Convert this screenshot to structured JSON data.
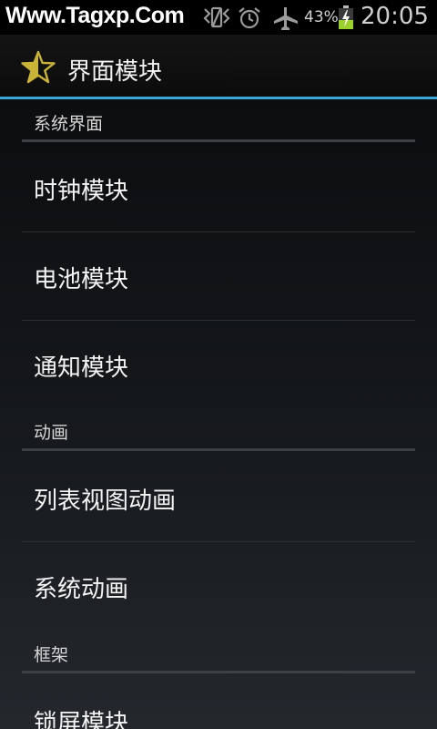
{
  "status_bar": {
    "watermark": "Www.Tagxp.Com",
    "battery_percent": "43%",
    "time": "20:05",
    "icons": [
      "vibrate-icon",
      "alarm-clock-icon",
      "airplane-mode-icon",
      "battery-charging-icon"
    ],
    "battery_level": 0.43
  },
  "action_bar": {
    "title": "界面模块",
    "icon": "star-icon",
    "accent_color": "#3aa7d6"
  },
  "sections": [
    {
      "header": "系统界面",
      "items": [
        "时钟模块",
        "电池模块",
        "通知模块"
      ]
    },
    {
      "header": "动画",
      "items": [
        "列表视图动画",
        "系统动画"
      ]
    },
    {
      "header": "框架",
      "items": [
        "锁屏模块"
      ]
    }
  ]
}
